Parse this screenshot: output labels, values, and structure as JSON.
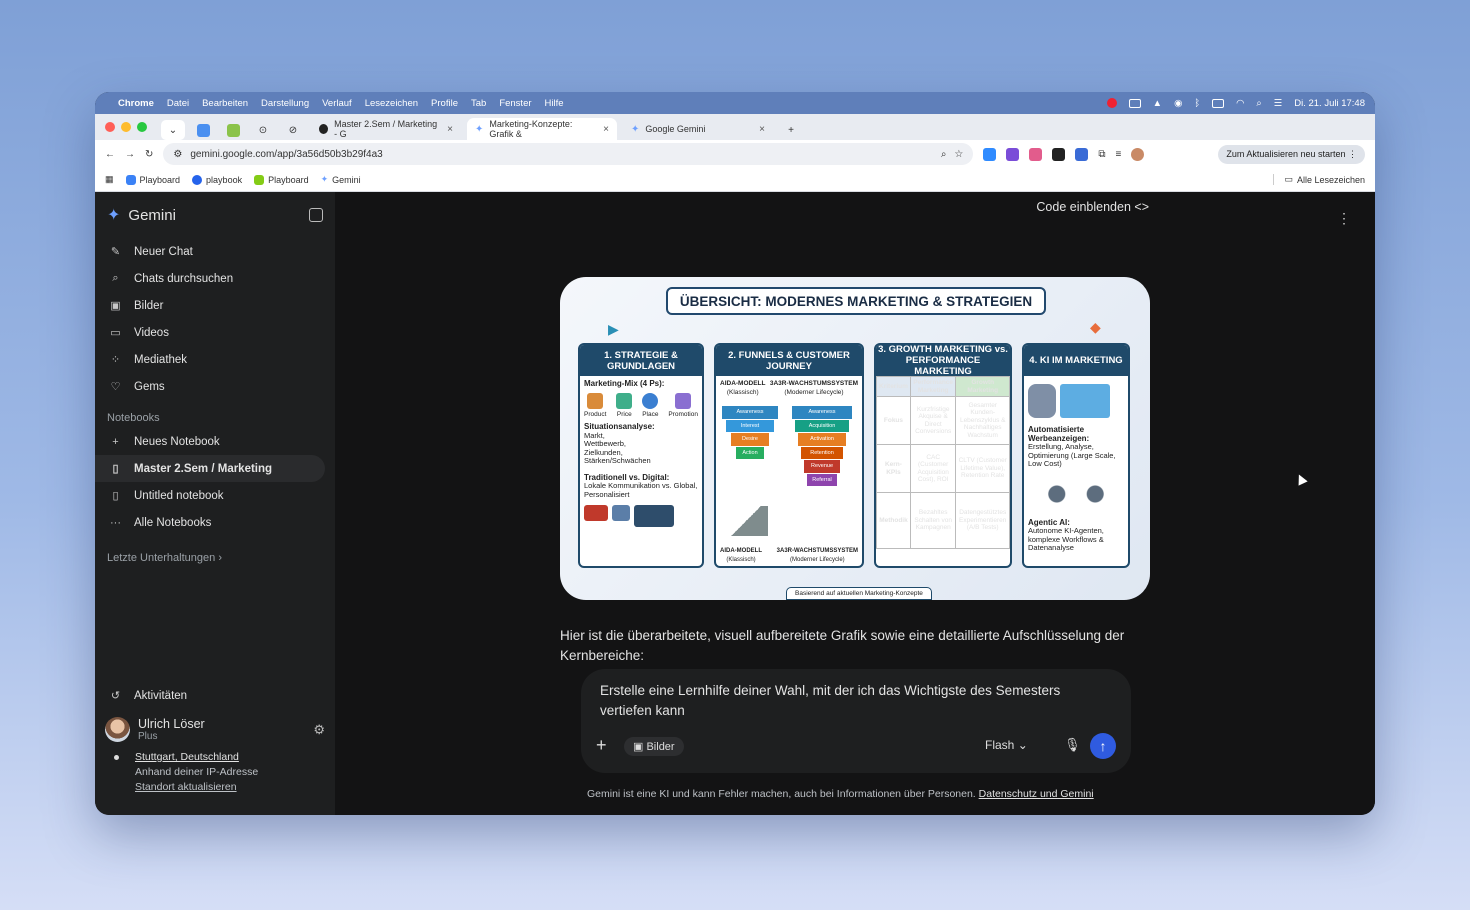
{
  "menubar": {
    "app": "Chrome",
    "items": [
      "Datei",
      "Bearbeiten",
      "Darstellung",
      "Verlauf",
      "Lesezeichen",
      "Profile",
      "Tab",
      "Fenster",
      "Hilfe"
    ],
    "datetime": "Di. 21. Juli 17:48"
  },
  "tabs": [
    {
      "label": "Master 2.Sem / Marketing - G",
      "active": false
    },
    {
      "label": "Marketing-Konzepte: Grafik &",
      "active": true
    },
    {
      "label": "Google Gemini",
      "active": false
    }
  ],
  "address": {
    "url": "gemini.google.com/app/3a56d50b3b29f4a3",
    "update_label": "Zum Aktualisieren neu starten"
  },
  "bookmarks": {
    "items": [
      "Playboard",
      "playbook",
      "Playboard",
      "Gemini"
    ],
    "all_label": "Alle Lesezeichen"
  },
  "sidebar": {
    "brand": "Gemini",
    "nav": [
      {
        "icon": "edit-icon",
        "label": "Neuer Chat"
      },
      {
        "icon": "search-icon",
        "label": "Chats durchsuchen"
      },
      {
        "icon": "image-icon",
        "label": "Bilder"
      },
      {
        "icon": "video-icon",
        "label": "Videos"
      },
      {
        "icon": "grid-icon",
        "label": "Mediathek"
      },
      {
        "icon": "gem-icon",
        "label": "Gems"
      }
    ],
    "notebooks_heading": "Notebooks",
    "notebooks": [
      {
        "label": "Neues Notebook"
      },
      {
        "label": "Master 2.Sem / Marketing",
        "selected": true
      },
      {
        "label": "Untitled notebook"
      },
      {
        "label": "Alle Notebooks"
      }
    ],
    "recent_label": "Letzte Unterhaltungen",
    "activity_label": "Aktivitäten",
    "user": {
      "name": "Ulrich Löser",
      "plan": "Plus"
    },
    "location": {
      "city": "Stuttgart, Deutschland",
      "basis": "Anhand deiner IP-Adresse",
      "update": "Standort aktualisieren"
    }
  },
  "main": {
    "embed_label": "Code einblenden <>",
    "infographic": {
      "title": "ÜBERSICHT: MODERNES MARKETING & STRATEGIEN",
      "panels": [
        {
          "title": "1. STRATEGIE & GRUNDLAGEN",
          "h1": "Marketing-Mix (4 Ps):",
          "ps": [
            "Product",
            "Price",
            "Place",
            "Promotion"
          ],
          "h2": "Situationsanalyse:",
          "t2": "Markt, Wettbewerb, Zielkunden, Stärken/Schwächen",
          "h3": "Traditionell vs. Digital:",
          "t3": "Lokale Kommunikation vs. Global, Personalisiert"
        },
        {
          "title": "2. FUNNELS & CUSTOMER JOURNEY",
          "left_label": "AIDA-MODELL",
          "left_sub": "(Klassisch)",
          "right_label": "3A3R-WACHSTUMSSYSTEM",
          "right_sub": "(Moderner Lifecycle)",
          "aida": [
            "Awareness",
            "Interest",
            "Desire",
            "Action"
          ],
          "aarrr": [
            "Awareness",
            "Acquisition",
            "Activation",
            "Retention",
            "Revenue",
            "Referral"
          ]
        },
        {
          "title": "3. GROWTH MARKETING vs. PERFORMANCE MARKETING",
          "cols": [
            "Kriterium",
            "Performance Marketing",
            "Growth Marketing"
          ],
          "rows": [
            [
              "Fokus",
              "Kurzfristige Akquise & Direct Conversions",
              "Gesamter Kunden-Lebenszyklus & Nachhaltiges Wachstum"
            ],
            [
              "Kern-KPIs",
              "CAC (Customer Acquisition Cost), ROI",
              "CLTV (Customer Lifetime Value), Retention Rate"
            ],
            [
              "Methodik",
              "Bezahltes Schalten von Kampagnen",
              "Datengestütztes Experimentieren (A/B Tests)"
            ]
          ]
        },
        {
          "title": "4. KI IM MARKETING",
          "h1": "Automatisierte Werbeanzeigen:",
          "t1": "Erstellung, Analyse, Optimierung (Large Scale, Low Cost)",
          "h2": "Agentic AI:",
          "t2": "Autonome KI-Agenten, komplexe Workflows & Datenanalyse"
        }
      ],
      "footer": "Basierend auf aktuellen Marketing-Konzepte"
    },
    "response": "Hier ist die überarbeitete, visuell aufbereitete Grafik sowie eine detaillierte Aufschlüsselung der Kernbereiche:",
    "composer": {
      "text": "Erstelle eine Lernhilfe deiner Wahl, mit der ich das Wichtigste des Semesters vertiefen kann",
      "tools_label": "Bilder",
      "model": "Flash"
    },
    "disclaimer": "Gemini ist eine KI und kann Fehler machen, auch bei Informationen über Personen.",
    "privacy_link": "Datenschutz und Gemini"
  }
}
